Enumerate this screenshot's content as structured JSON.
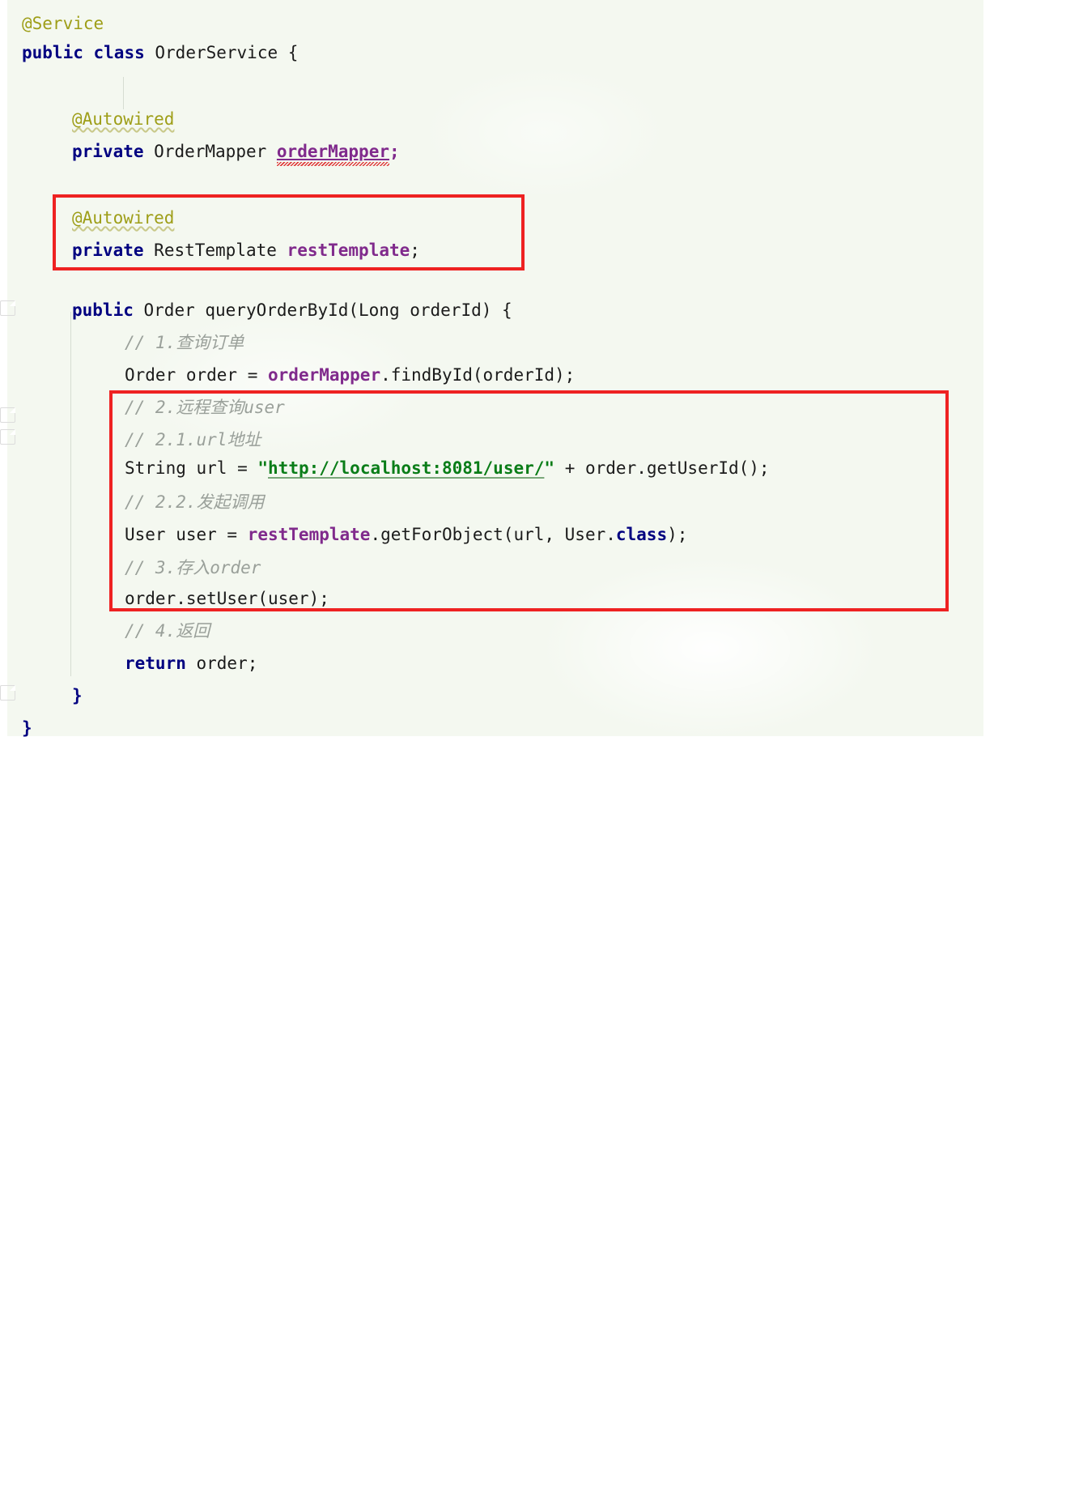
{
  "editor": {
    "language": "java",
    "background_color": "#f4f8f0",
    "font_size_px": 21,
    "class_name": "OrderService"
  },
  "colors": {
    "keyword": "#000080",
    "annotation": "#9e9e18",
    "field": "#802a8c",
    "comment": "#9aa09a",
    "string": "#0a7d18",
    "plain_text": "#1b1b1b",
    "highlight_box": "#ee2222",
    "error_squiggle": "#e03b3b",
    "indent_guide": "#d6ddd2"
  },
  "code": {
    "line_01_annotation": "@Service",
    "line_02_kw_public": "public",
    "line_02_kw_class": "class",
    "line_02_name": "OrderService",
    "line_02_brace": "{",
    "line_04_annotation": "@Autowired",
    "line_05_kw": "private",
    "line_05_type": "OrderMapper",
    "line_05_field": "orderMapper",
    "line_05_semi": ";",
    "line_07_annotation": "@Autowired",
    "line_08_kw": "private",
    "line_08_type": "RestTemplate",
    "line_08_field": "restTemplate",
    "line_08_semi": ";",
    "line_10_kw": "public",
    "line_10_sig": "Order queryOrderById(Long orderId) {",
    "line_11_comment": "// 1.查询订单",
    "line_12_pre": "Order order = ",
    "line_12_field": "orderMapper",
    "line_12_post": ".findById(orderId);",
    "line_13_comment": "// 2.远程查询user",
    "line_14_comment": "// 2.1.url地址",
    "line_15_pre": "String url = ",
    "line_15_quote_open": "\"",
    "line_15_url": "http://localhost:8081/user/",
    "line_15_quote_close": "\"",
    "line_15_post": " + order.getUserId();",
    "line_16_comment": "// 2.2.发起调用",
    "line_17_pre": "User user = ",
    "line_17_field": "restTemplate",
    "line_17_mid": ".getForObject(url, User.",
    "line_17_kw": "class",
    "line_17_post": ");",
    "line_18_comment": "// 3.存入order",
    "line_19_stmt": "order.setUser(user);",
    "line_20_comment": "// 4.返回",
    "line_21_kw": "return",
    "line_21_expr": " order;",
    "line_22_brace": "}",
    "line_23_brace": "}"
  },
  "highlights": [
    {
      "name": "rest-template-field-highlight",
      "covers": "@Autowired private RestTemplate restTemplate;"
    },
    {
      "name": "remote-call-block-highlight",
      "covers": "// 2.远程查询user through order.setUser(user);"
    }
  ]
}
